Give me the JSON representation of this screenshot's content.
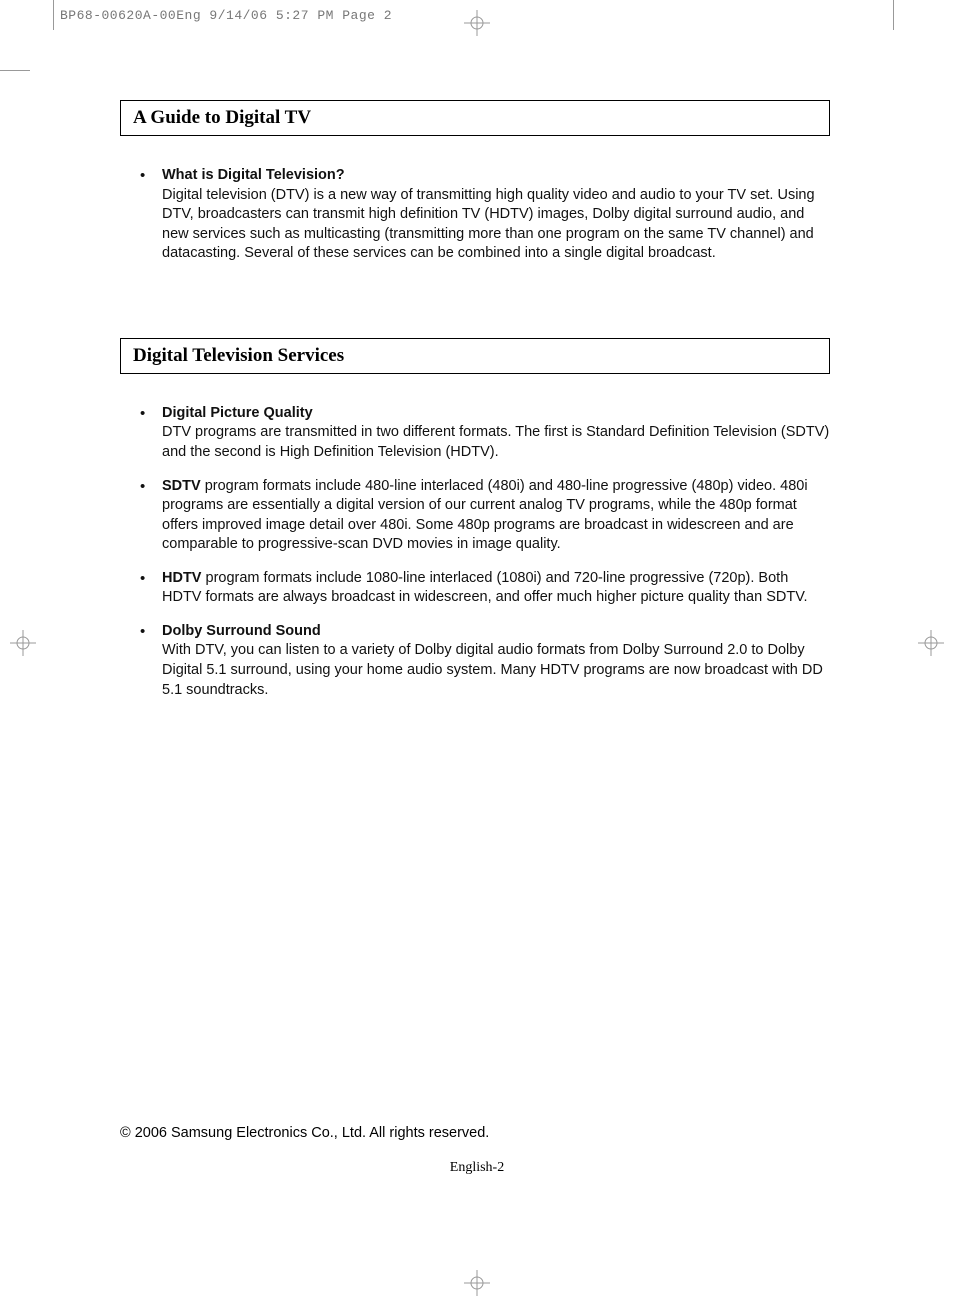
{
  "slug": "BP68-00620A-00Eng  9/14/06  5:27 PM  Page 2",
  "sections": [
    {
      "title": "A Guide to Digital TV",
      "items": [
        {
          "lead": "What is Digital Television?",
          "body": "Digital television (DTV) is a new way of transmitting high quality video and audio to your TV set. Using DTV, broadcasters can transmit high definition TV (HDTV) images, Dolby digital surround audio, and new services such as multicasting (transmitting more than one program on the same TV channel) and datacasting. Several of these services can be combined into a single digital broadcast."
        }
      ]
    },
    {
      "title": "Digital Television Services",
      "items": [
        {
          "lead": "Digital Picture Quality",
          "body": "DTV programs are transmitted in two different formats. The first is Standard Definition Television (SDTV) and the second is High Definition Television (HDTV)."
        },
        {
          "lead_inline": "SDTV",
          "body": " program formats include 480-line interlaced (480i) and 480-line progressive (480p) video. 480i programs are essentially a digital version of our current analog TV programs, while the 480p format offers improved image detail over 480i. Some 480p programs are broadcast in widescreen and are comparable to progressive-scan DVD movies in image quality."
        },
        {
          "lead_inline": "HDTV",
          "body": " program formats include 1080-line interlaced (1080i) and 720-line progressive (720p). Both HDTV formats are always broadcast in widescreen, and offer much higher picture quality than SDTV."
        },
        {
          "lead": "Dolby Surround Sound",
          "body": "With DTV, you can listen to a variety of Dolby digital audio formats from Dolby Surround 2.0 to Dolby Digital 5.1 surround, using your home audio system. Many HDTV programs are now broadcast with DD 5.1 soundtracks."
        }
      ]
    }
  ],
  "copyright": "© 2006 Samsung Electronics Co., Ltd. All rights reserved.",
  "pagenum": "English-2"
}
